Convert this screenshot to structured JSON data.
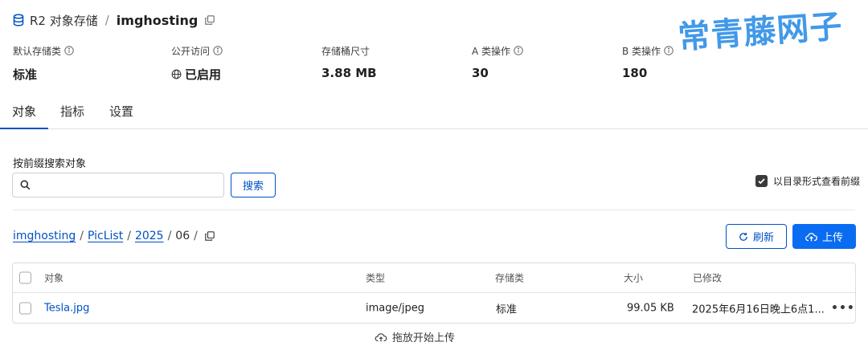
{
  "header": {
    "service": "R2 对象存储",
    "separator": "/",
    "bucket": "imghosting",
    "icons": {
      "storage": "database-icon",
      "copy": "copy-icon"
    }
  },
  "watermark": "常青藤网子",
  "stats": [
    {
      "label": "默认存储类",
      "value": "标准",
      "info": true,
      "icon": null
    },
    {
      "label": "公开访问",
      "value": "已启用",
      "info": true,
      "icon": "globe-icon"
    },
    {
      "label": "存储桶尺寸",
      "value": "3.88 MB",
      "info": false,
      "icon": null
    },
    {
      "label": "A 类操作",
      "value": "30",
      "info": true,
      "icon": null
    },
    {
      "label": "B 类操作",
      "value": "180",
      "info": true,
      "icon": null
    }
  ],
  "tabs": [
    {
      "label": "对象",
      "active": true
    },
    {
      "label": "指标",
      "active": false
    },
    {
      "label": "设置",
      "active": false
    }
  ],
  "search": {
    "label": "按前缀搜索对象",
    "placeholder": "",
    "value": "",
    "button": "搜索",
    "directory_toggle": {
      "label": "以目录形式查看前缀",
      "checked": true
    }
  },
  "breadcrumb": {
    "segments": [
      {
        "text": "imghosting",
        "link": true
      },
      {
        "text": "PicList",
        "link": true
      },
      {
        "text": "2025",
        "link": true
      },
      {
        "text": "06",
        "link": false
      }
    ],
    "separator": "/"
  },
  "actions": {
    "refresh": "刷新",
    "upload": "上传"
  },
  "table": {
    "columns": [
      "对象",
      "类型",
      "存储类",
      "大小",
      "已修改"
    ],
    "rows": [
      {
        "name": "Tesla.jpg",
        "type": "image/jpeg",
        "storage_class": "标准",
        "size": "99.05 KB",
        "modified": "2025年6月16日晚上6点1..."
      }
    ],
    "more_label": "•••"
  },
  "dropzone": {
    "label": "拖放开始上传"
  },
  "colors": {
    "accent": "#0051c3",
    "primary_button": "#0a6cf0",
    "watermark": "#2e8fe6"
  }
}
